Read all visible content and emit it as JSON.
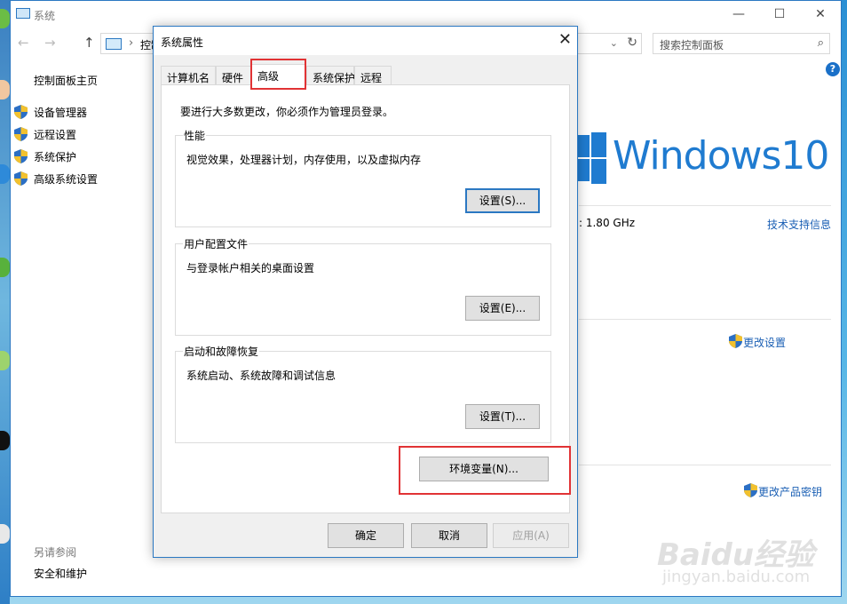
{
  "window": {
    "title": "系统",
    "controls": {
      "minimize": "—",
      "maximize": "☐",
      "close": "✕"
    }
  },
  "nav": {
    "back": "←",
    "forward": "→",
    "up": "↑",
    "breadcrumb_sep": "›",
    "breadcrumb": "控制",
    "dropdown": "⌄",
    "refresh": "↻",
    "search_placeholder": "搜索控制面板",
    "search_glyph": "⌕"
  },
  "help": "?",
  "sidebar": {
    "home": "控制面板主页",
    "items": [
      {
        "label": "设备管理器",
        "icon": "uac-shield-icon"
      },
      {
        "label": "远程设置",
        "icon": "uac-shield-icon"
      },
      {
        "label": "系统保护",
        "icon": "uac-shield-icon"
      },
      {
        "label": "高级系统设置",
        "icon": "uac-shield-icon"
      }
    ],
    "see_also": "另请参阅",
    "security_link": "安全和维护"
  },
  "main": {
    "os_wordmark": "Windows10",
    "cpu_speed": ":   1.80 GHz",
    "support_link": "技术支持信息",
    "change_settings": "更改设置",
    "change_key": "更改产品密钥"
  },
  "dialog": {
    "title": "系统属性",
    "close": "✕",
    "tabs": [
      "计算机名",
      "硬件",
      "高级",
      "系统保护",
      "远程"
    ],
    "active_tab": "高级",
    "intro": "要进行大多数更改，你必须作为管理员登录。",
    "groups": [
      {
        "legend": "性能",
        "desc": "视觉效果，处理器计划，内存使用，以及虚拟内存",
        "button": "设置(S)..."
      },
      {
        "legend": "用户配置文件",
        "desc": "与登录帐户相关的桌面设置",
        "button": "设置(E)..."
      },
      {
        "legend": "启动和故障恢复",
        "desc": "系统启动、系统故障和调试信息",
        "button": "设置(T)..."
      }
    ],
    "env_button": "环境变量(N)...",
    "ok": "确定",
    "cancel": "取消",
    "apply": "应用(A)"
  },
  "watermark": {
    "brand": "Baidu经验",
    "url": "jingyan.baidu.com"
  },
  "colors": {
    "accent": "#2b78c2",
    "link": "#1a5fb4",
    "highlight": "#e13335",
    "windows_blue": "#1f7bd0"
  }
}
